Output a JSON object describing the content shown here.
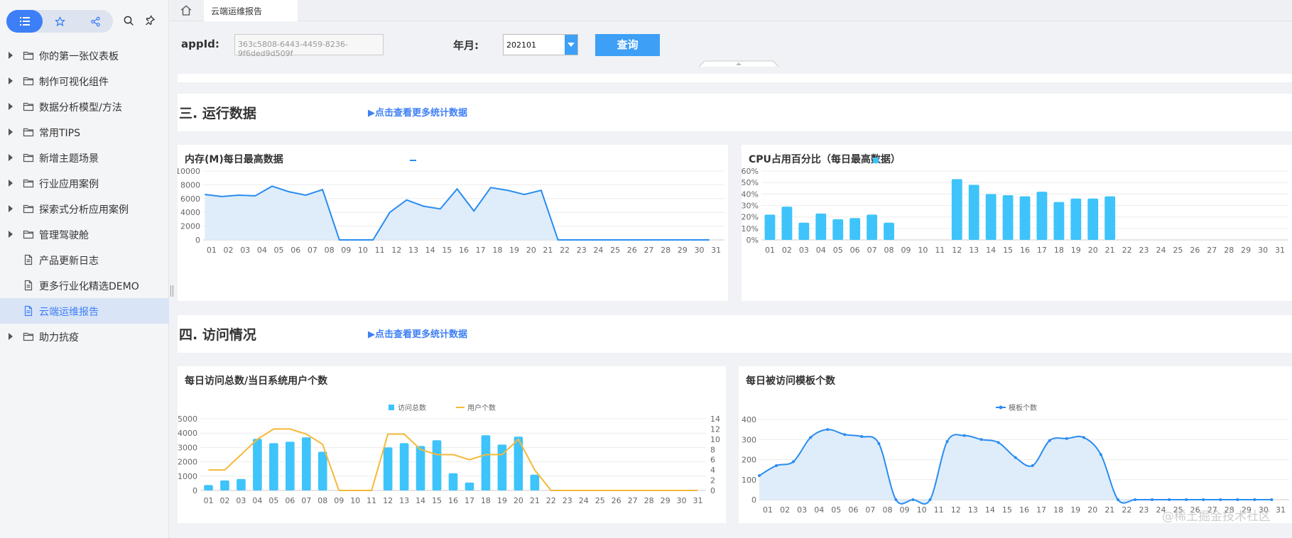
{
  "sidebar": {
    "top_icons": [
      "list-icon",
      "star-icon",
      "share-icon"
    ],
    "tools": [
      "search-icon",
      "pin-icon"
    ],
    "items": [
      {
        "label": "你的第一张仪表板",
        "type": "folder",
        "expandable": true
      },
      {
        "label": "制作可视化组件",
        "type": "folder",
        "expandable": true
      },
      {
        "label": "数据分析模型/方法",
        "type": "folder",
        "expandable": true
      },
      {
        "label": "常用TIPS",
        "type": "folder",
        "expandable": true
      },
      {
        "label": "新增主题场景",
        "type": "folder",
        "expandable": true
      },
      {
        "label": "行业应用案例",
        "type": "folder",
        "expandable": true
      },
      {
        "label": "探索式分析应用案例",
        "type": "folder",
        "expandable": true
      },
      {
        "label": "管理驾驶舱",
        "type": "folder",
        "expandable": true
      },
      {
        "label": "产品更新日志",
        "type": "doc",
        "expandable": false
      },
      {
        "label": "更多行业化精选DEMO",
        "type": "doc",
        "expandable": false
      },
      {
        "label": "云端运维报告",
        "type": "doc",
        "expandable": false,
        "active": true
      },
      {
        "label": "助力抗疫",
        "type": "folder",
        "expandable": true
      }
    ]
  },
  "tabs": {
    "home_icon": "home-icon",
    "active_tab": "云端运维报告"
  },
  "filters": {
    "appid_label": "appId:",
    "appid_value": "363c5808-6443-4459-8236-9f6ded9d509f",
    "month_label": "年月:",
    "month_value": "202101",
    "query_label": "查询"
  },
  "sections": {
    "run": {
      "title": "三. 运行数据",
      "link": "▶点击查看更多统计数据"
    },
    "visit": {
      "title": "四. 访问情况",
      "link": "▶点击查看更多统计数据"
    }
  },
  "panels": {
    "mem_title": "内存(M)每日最高数据",
    "cpu_title": "CPU占用百分比（每日最高数据）",
    "visits_title": "每日访问总数/当日系统用户个数",
    "templates_title": "每日被访问模板个数"
  },
  "colors": {
    "accent": "#3d7ff6",
    "bar": "#3ec4fa",
    "line_blue": "#2a8cf0",
    "line_yellow": "#f5b93a",
    "area": "#dcebfb"
  },
  "watermark": "@稀土掘金技术社区",
  "chart_data": [
    {
      "type": "area",
      "title": "内存(M)每日最高数据",
      "x": [
        "01",
        "02",
        "03",
        "04",
        "05",
        "06",
        "07",
        "08",
        "09",
        "10",
        "11",
        "12",
        "13",
        "14",
        "15",
        "16",
        "17",
        "18",
        "19",
        "20",
        "21",
        "22",
        "23",
        "24",
        "25",
        "26",
        "27",
        "28",
        "29",
        "30",
        "31"
      ],
      "values": [
        6600,
        6300,
        6500,
        6400,
        7800,
        7000,
        6500,
        7300,
        0,
        0,
        0,
        4000,
        5800,
        4900,
        4500,
        7400,
        4200,
        7600,
        7200,
        6600,
        7200,
        0,
        0,
        0,
        0,
        0,
        0,
        0,
        0,
        0,
        0
      ],
      "ylim": [
        0,
        10000
      ],
      "yticks": [
        "10000",
        "8000",
        "6000",
        "4000",
        "2000",
        "0"
      ],
      "legend_marker": "line",
      "grid": true
    },
    {
      "type": "bar",
      "title": "CPU占用百分比（每日最高数据）",
      "x": [
        "01",
        "02",
        "03",
        "04",
        "05",
        "06",
        "07",
        "08",
        "09",
        "10",
        "11",
        "12",
        "13",
        "14",
        "15",
        "16",
        "17",
        "18",
        "19",
        "20",
        "21",
        "22",
        "23",
        "24",
        "25",
        "26",
        "27",
        "28",
        "29",
        "30",
        "31"
      ],
      "values": [
        22,
        29,
        15,
        23,
        18,
        19,
        22,
        15,
        0,
        0,
        0,
        53,
        48,
        40,
        39,
        38,
        42,
        33,
        36,
        36,
        38,
        0,
        0,
        0,
        0,
        0,
        0,
        0,
        0,
        0,
        0
      ],
      "ylim": [
        0,
        60
      ],
      "yticks": [
        "60%",
        "50%",
        "40%",
        "30%",
        "20%",
        "10%",
        "0%"
      ],
      "legend_marker": "square",
      "grid": true
    },
    {
      "type": "bar",
      "title": "每日访问总数/当日系统用户个数",
      "x": [
        "01",
        "02",
        "03",
        "04",
        "05",
        "06",
        "07",
        "08",
        "09",
        "10",
        "11",
        "12",
        "13",
        "14",
        "15",
        "16",
        "17",
        "18",
        "19",
        "20",
        "21",
        "22",
        "23",
        "24",
        "25",
        "26",
        "27",
        "28",
        "29",
        "30",
        "31"
      ],
      "series": [
        {
          "name": "访问总数",
          "type": "bar",
          "axis": "left",
          "values": [
            380,
            700,
            800,
            3600,
            3300,
            3400,
            3700,
            2700,
            0,
            0,
            0,
            3000,
            3300,
            3100,
            3500,
            1200,
            550,
            3850,
            3200,
            3750,
            1100,
            0,
            0,
            0,
            0,
            0,
            0,
            0,
            0,
            0,
            0
          ]
        },
        {
          "name": "用户个数",
          "type": "line",
          "axis": "right",
          "values": [
            4,
            4,
            7,
            10,
            12,
            12,
            11,
            9,
            0,
            0,
            0,
            11,
            11,
            8,
            7,
            7,
            6,
            7,
            7,
            10,
            4,
            0,
            0,
            0,
            0,
            0,
            0,
            0,
            0,
            0,
            0
          ]
        }
      ],
      "ylim": [
        0,
        5000
      ],
      "y2lim": [
        0,
        14
      ],
      "yticks": [
        "5000",
        "4000",
        "3000",
        "2000",
        "1000",
        "0"
      ],
      "y2ticks": [
        "14",
        "12",
        "10",
        "8",
        "6",
        "4",
        "2",
        "0"
      ],
      "legend_position": "top-center",
      "grid": true
    },
    {
      "type": "area",
      "title": "每日被访问模板个数",
      "x": [
        "01",
        "02",
        "03",
        "04",
        "05",
        "06",
        "07",
        "08",
        "09",
        "10",
        "11",
        "12",
        "13",
        "14",
        "15",
        "16",
        "17",
        "18",
        "19",
        "20",
        "21",
        "22",
        "23",
        "24",
        "25",
        "26",
        "27",
        "28",
        "29",
        "30",
        "31"
      ],
      "series": [
        {
          "name": "模板个数",
          "type": "line",
          "smooth": true,
          "values": [
            120,
            170,
            190,
            310,
            350,
            325,
            315,
            280,
            0,
            0,
            0,
            290,
            320,
            300,
            285,
            210,
            170,
            295,
            305,
            310,
            225,
            0,
            0,
            0,
            0,
            0,
            0,
            0,
            0,
            0,
            0
          ]
        }
      ],
      "ylim": [
        0,
        400
      ],
      "yticks": [
        "400",
        "300",
        "200",
        "100",
        "0"
      ],
      "legend_position": "top-center",
      "grid": true
    }
  ]
}
